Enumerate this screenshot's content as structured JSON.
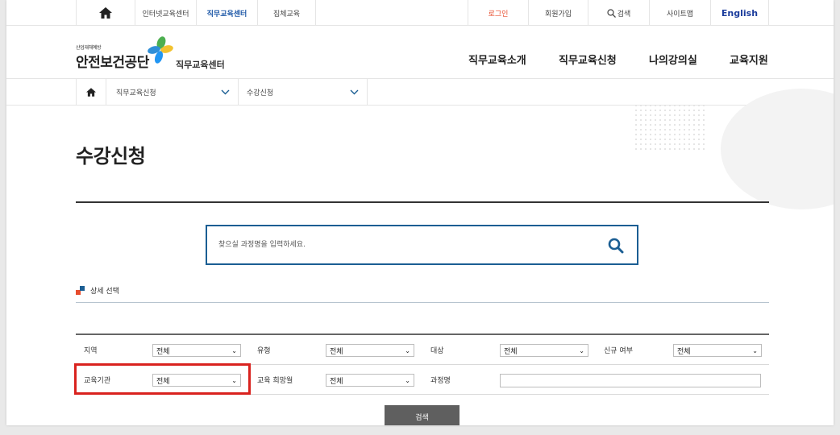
{
  "util_bar": {
    "links": [
      "인터넷교육센터",
      "직무교육센터",
      "집체교육"
    ],
    "login": "로그인",
    "join": "회원가입",
    "search": "검색",
    "sitemap": "사이트맵",
    "english": "English"
  },
  "header": {
    "logo_small": "산업재해예방",
    "logo_name": "안전보건공단",
    "logo_sub": "직무교육센터",
    "nav": [
      "직무교육소개",
      "직무교육신청",
      "나의강의실",
      "교육지원"
    ]
  },
  "location": {
    "depth1": "직무교육신청",
    "depth2": "수강신청"
  },
  "page_title": "수강신청",
  "search": {
    "placeholder": "찾으실 과정명을 입력하세요."
  },
  "detail_section": "상세 선택",
  "filters": {
    "row1": [
      {
        "label": "지역",
        "value": "전체"
      },
      {
        "label": "유형",
        "value": "전체"
      },
      {
        "label": "대상",
        "value": "전체"
      },
      {
        "label": "신규 여부",
        "value": "전체"
      }
    ],
    "row2": [
      {
        "label": "교육기관",
        "value": "전체"
      },
      {
        "label": "교육 희망월",
        "value": "전체"
      },
      {
        "label": "과정명",
        "value": ""
      }
    ]
  },
  "search_button": "검색",
  "colors": {
    "accent_blue": "#1b5e93",
    "highlight_red": "#d9221e",
    "login_red": "#e74c2d"
  }
}
